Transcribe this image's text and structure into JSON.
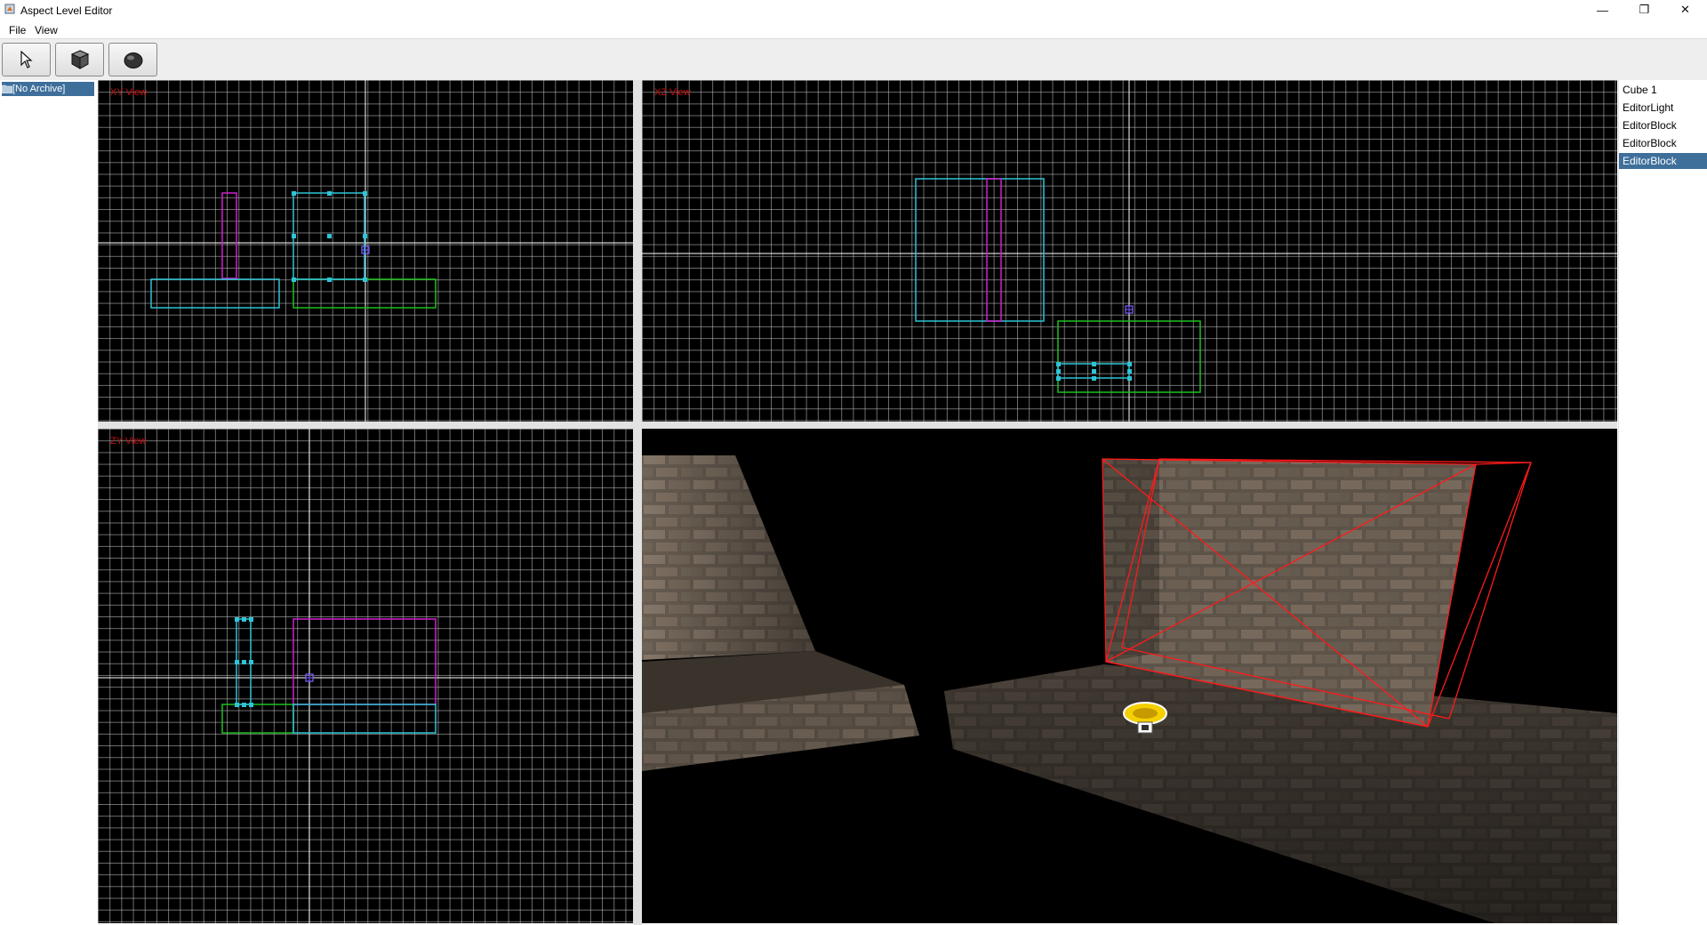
{
  "window": {
    "title": "Aspect Level Editor",
    "controls": {
      "minimize": "—",
      "maximize": "❐",
      "close": "✕"
    }
  },
  "menu": {
    "items": [
      "File",
      "View"
    ]
  },
  "toolbar": {
    "tools": [
      {
        "name": "select-tool",
        "icon": "cursor-arrow-icon",
        "active": true
      },
      {
        "name": "cube-tool",
        "icon": "cube-icon",
        "active": false
      },
      {
        "name": "sphere-tool",
        "icon": "sphere-icon",
        "active": false
      }
    ]
  },
  "archive_tree": {
    "root_label": "[No Archive]"
  },
  "views": {
    "xy": {
      "label": "XY View"
    },
    "xz": {
      "label": "XZ View"
    },
    "zy": {
      "label": "ZY View"
    }
  },
  "scene": {
    "items": [
      "Cube 1",
      "EditorLight",
      "EditorBlock",
      "EditorBlock",
      "EditorBlock"
    ],
    "selected_index": 4
  },
  "colors": {
    "grid_bg": "#000000",
    "grid_line": "#c8c8c8",
    "view_label": "#c81010",
    "cyan_block": "#2ec4d6",
    "green_block": "#1fbf1f",
    "magenta_block": "#d020d0",
    "selection": "#3e6f9b",
    "wireframe": "#ff1a1a"
  }
}
